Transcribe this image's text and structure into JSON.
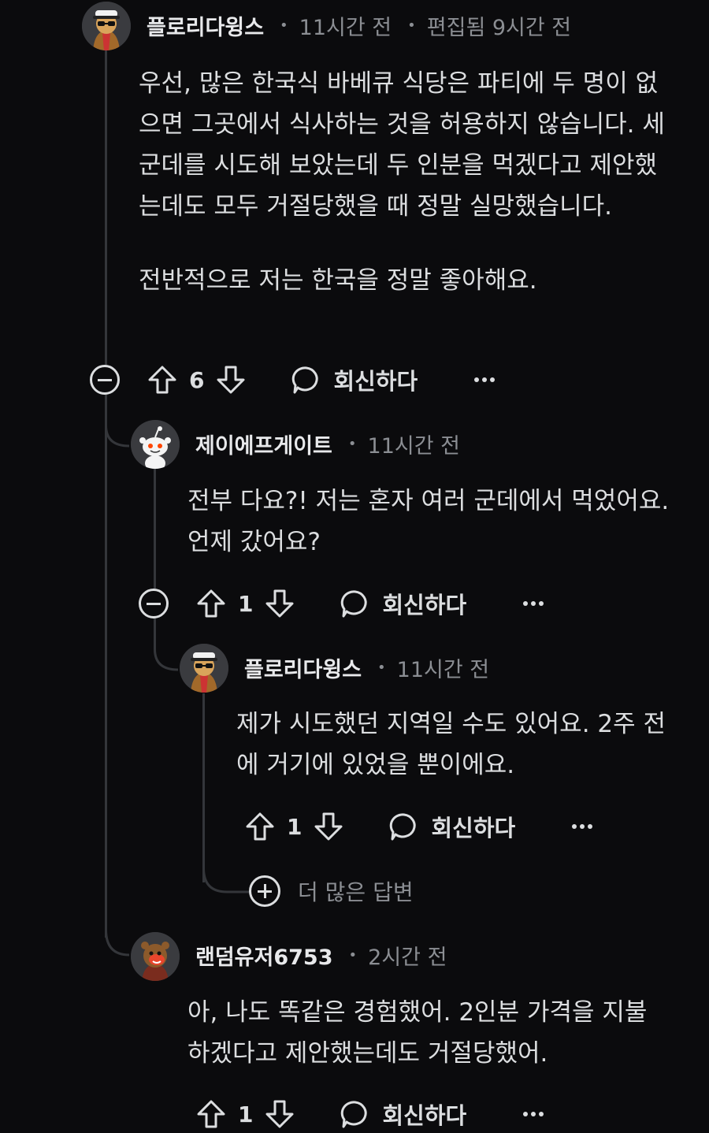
{
  "comments": [
    {
      "author": "플로리다윙스",
      "time": "11시간 전",
      "edited": "편집됨 9시간 전",
      "paragraphs": [
        "우선, 많은 한국식 바베큐 식당은 파티에 두 명이 없으면 그곳에서 식사하는 것을 허용하지 않습니다. 세 군데를 시도해 보았는데 두 인분을 먹겠다고 제안했는데도 모두 거절당했을 때 정말 실망했습니다.",
        "전반적으로 저는 한국을 정말 좋아해요."
      ],
      "votes": "6",
      "reply_label": "회신하다",
      "avatar_icon": "sunglasses-cap-avatar-icon"
    },
    {
      "author": "제이에프게이트",
      "time": "11시간 전",
      "paragraphs": [
        "전부 다요?! 저는 혼자 여러 군데에서 먹었어요. 언제 갔어요?"
      ],
      "votes": "1",
      "reply_label": "회신하다",
      "avatar_icon": "reddit-snoo-avatar-icon"
    },
    {
      "author": "플로리다윙스",
      "time": "11시간 전",
      "paragraphs": [
        "제가 시도했던 지역일 수도 있어요. 2주 전에 거기에 있었을 뿐이에요."
      ],
      "votes": "1",
      "reply_label": "회신하다",
      "avatar_icon": "sunglasses-cap-avatar-icon"
    },
    {
      "author": "랜덤유저6753",
      "time": "2시간 전",
      "paragraphs": [
        "아, 나도 똑같은 경험했어. 2인분 가격을 지불하겠다고 제안했는데도 거절당했어."
      ],
      "votes": "1",
      "reply_label": "회신하다",
      "avatar_icon": "bear-avatar-icon"
    }
  ],
  "more_replies_label": "더 많은 답변",
  "colors": {
    "background": "#0b0b0d",
    "text": "#dcdee0",
    "muted": "#8b8e93",
    "thread_line": "#34363a"
  }
}
